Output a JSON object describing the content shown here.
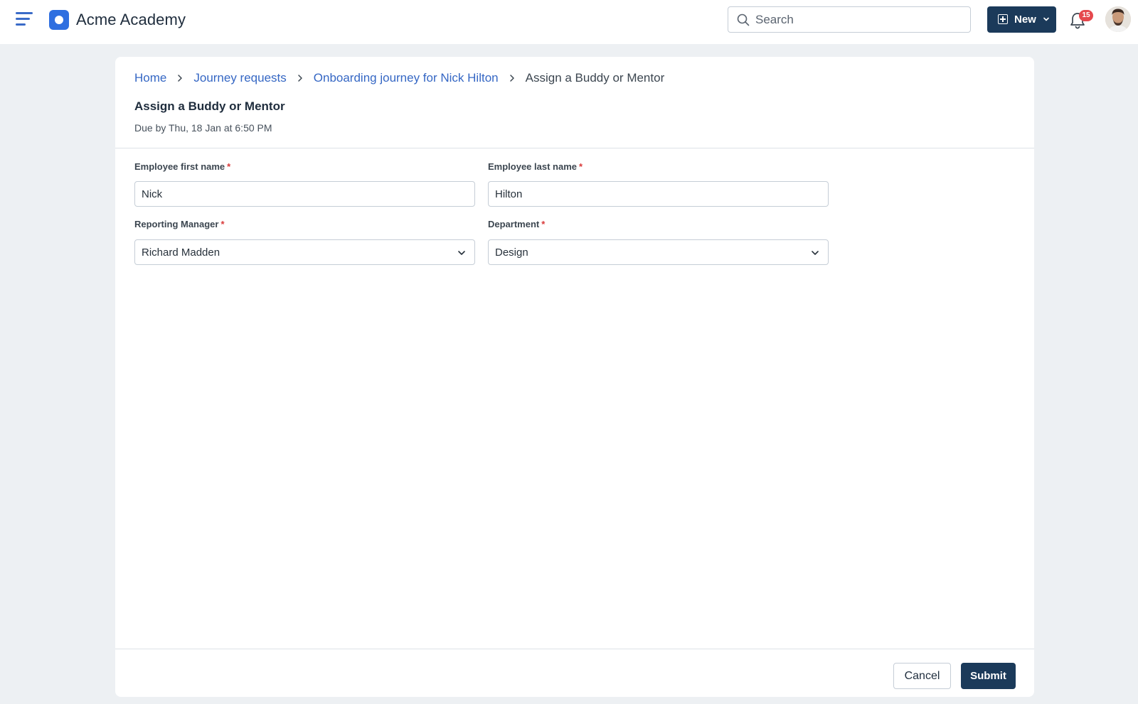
{
  "header": {
    "app_title": "Acme Academy",
    "search_placeholder": "Search",
    "new_label": "New",
    "notification_count": "15",
    "brand_color": "#2f6fe0",
    "primary_color": "#1b3a5a",
    "badge_color": "#e5484d",
    "icons": [
      "hamburger-icon",
      "logo-icon",
      "search-icon",
      "plus-icon",
      "chevron-down-icon",
      "bell-icon",
      "avatar"
    ]
  },
  "breadcrumb": {
    "items": [
      "Home",
      "Journey requests",
      "Onboarding journey for Nick Hilton"
    ],
    "current": "Assign a Buddy or Mentor"
  },
  "task": {
    "title": "Assign a Buddy or Mentor",
    "due": "Due by Thu, 18 Jan at 6:50 PM"
  },
  "form": {
    "first_name": {
      "label": "Employee first name",
      "required_mark": "*",
      "value": "Nick"
    },
    "last_name": {
      "label": "Employee last name",
      "required_mark": "*",
      "value": "Hilton"
    },
    "manager": {
      "label": "Reporting Manager",
      "required_mark": "*",
      "value": "Richard Madden"
    },
    "department": {
      "label": "Department",
      "required_mark": "*",
      "value": "Design"
    }
  },
  "actions": {
    "cancel_label": "Cancel",
    "submit_label": "Submit"
  }
}
